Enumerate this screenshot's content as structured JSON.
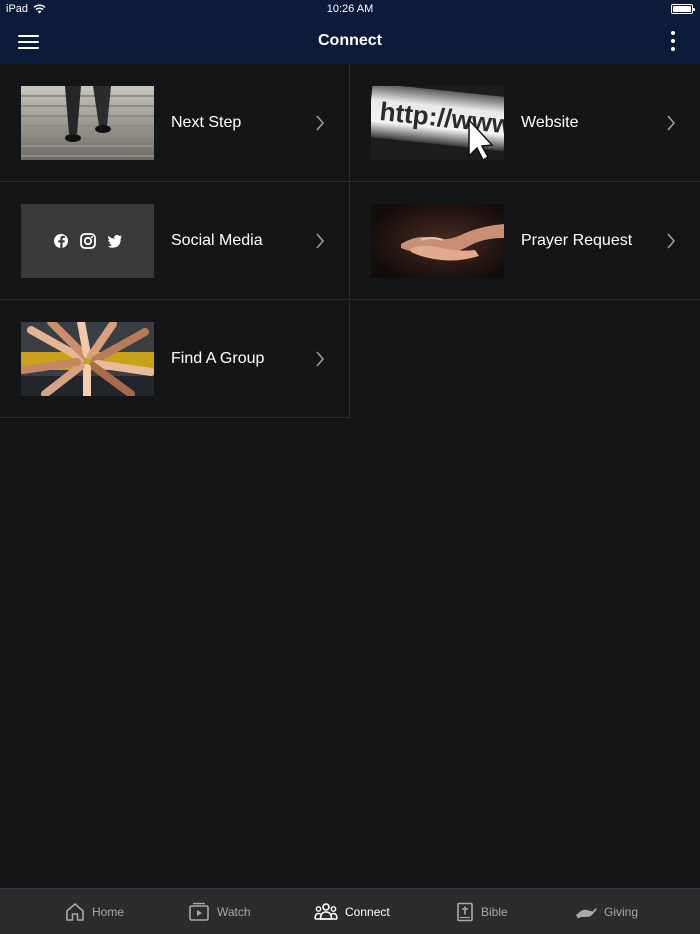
{
  "status_bar": {
    "device": "iPad",
    "time": "10:26 AM"
  },
  "header": {
    "title": "Connect",
    "menu_icon": "hamburger-menu-icon",
    "more_icon": "more-vertical-icon"
  },
  "tiles": [
    {
      "label": "Next Step",
      "image": "stairs-walking-photo"
    },
    {
      "label": "Website",
      "image": "http-www-url-bar-photo"
    },
    {
      "label": "Social Media",
      "image": "social-icons-tile",
      "icons": [
        "facebook-icon",
        "instagram-icon",
        "twitter-icon"
      ]
    },
    {
      "label": "Prayer Request",
      "image": "praying-hands-photo"
    },
    {
      "label": "Find A Group",
      "image": "stacked-hands-photo"
    }
  ],
  "website_image_text": "http://www",
  "tabbar": {
    "items": [
      {
        "label": "Home",
        "icon": "home-icon"
      },
      {
        "label": "Watch",
        "icon": "play-video-icon"
      },
      {
        "label": "Connect",
        "icon": "group-people-icon"
      },
      {
        "label": "Bible",
        "icon": "bible-book-icon"
      },
      {
        "label": "Giving",
        "icon": "giving-hand-icon"
      }
    ],
    "active": "Connect"
  },
  "colors": {
    "header_bg": "#0d1b3a",
    "page_bg": "#141517",
    "tabbar_bg": "#2b2c2e",
    "inactive_tab": "#a8a9ab"
  }
}
